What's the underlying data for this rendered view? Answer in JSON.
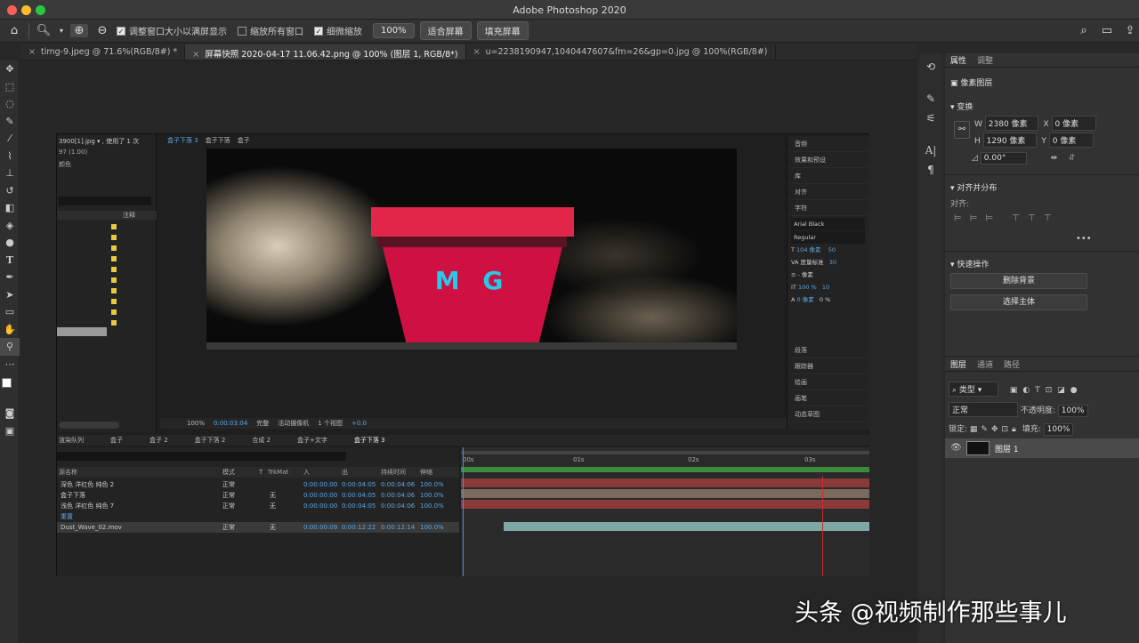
{
  "app": {
    "title": "Adobe Photoshop 2020"
  },
  "colors": {
    "accent": "#2680eb",
    "bar_red": "#e2264a",
    "pot_red": "#cf1042",
    "mg_text": "#26c9e8"
  },
  "options_bar": {
    "check_fit": "调整窗口大小以满屏显示",
    "check_zoom_all": "缩放所有窗口",
    "check_scrubby": "细微缩放",
    "zoom_value": "100%",
    "fit_screen": "适合屏幕",
    "fill_screen": "填充屏幕"
  },
  "tabs": [
    {
      "label": "timg-9.jpeg @ 71.6%(RGB/8#) *"
    },
    {
      "label": "屏幕快照 2020-04-17 11.06.42.png @ 100% (图层 1, RGB/8*)"
    },
    {
      "label": "u=2238190947,1040447607&fm=26&gp=0.jpg @ 100%(RGB/8#)"
    }
  ],
  "ae": {
    "project": {
      "file": "3900[1].jpg ▾ , 使用了 1 次",
      "line2": "97 (1.00)",
      "line3": "颜色",
      "col_note": "注释"
    },
    "breadcrumb": [
      "盒子下落 3",
      "盒子下落",
      "盒子"
    ],
    "comp_text": "M G",
    "viewer_bar": {
      "zoom": "100%",
      "time": "0:00:03:04",
      "quality": "完整",
      "camera": "活动摄像机",
      "views": "1 个视图",
      "offset": "+0.0"
    },
    "right_panels": [
      "音频",
      "效果和预设",
      "库",
      "对齐",
      "字符"
    ],
    "char": {
      "font": "Arial Black",
      "style": "Regular",
      "size": "104 像素",
      "kerning": "度量标准",
      "px": "- 像素",
      "scale_v": "100 %",
      "baseline": "0 像素",
      "tsize": "50",
      "track": "30",
      "t10": "10",
      "pct": "0 %"
    },
    "right_panels_bottom": [
      "段落",
      "跟踪器",
      "绘画",
      "画笔",
      "动态草图"
    ],
    "timeline_tabs": [
      "渲染队列",
      "盒子",
      "盒子 2",
      "盒子下落 2",
      "合成 2",
      "盒子+文字",
      "盒子下落 3"
    ],
    "tl_headers": {
      "name": "源名称",
      "mode": "模式",
      "t": "T",
      "trkmat": "TrkMat",
      "in": "入",
      "out": "出",
      "dur": "持续时间",
      "stretch": "伸缩"
    },
    "ruler": [
      "00s",
      "01s",
      "02s",
      "03s"
    ],
    "layers": [
      {
        "name": "深色 洋红色 纯色 2",
        "mode": "正常",
        "trk": "",
        "in": "0:00:00:00",
        "out": "0:00:04:05",
        "dur": "0:00:04:06",
        "stretch": "100.0%"
      },
      {
        "name": "盒子下落",
        "mode": "正常",
        "trk": "无",
        "in": "0:00:00:00",
        "out": "0:00:04:05",
        "dur": "0:00:04:06",
        "stretch": "100.0%"
      },
      {
        "name": "浅色 洋红色 纯色 7",
        "mode": "正常",
        "trk": "无",
        "in": "0:00:00:00",
        "out": "0:00:04:05",
        "dur": "0:00:04:06",
        "stretch": "100.0%"
      },
      {
        "name": "重置",
        "mode": "",
        "trk": "",
        "in": "",
        "out": "",
        "dur": "",
        "stretch": ""
      },
      {
        "name": "Dust_Wave_02.mov",
        "mode": "正常",
        "trk": "无",
        "in": "0:00:00:09",
        "out": "0:00:12:22",
        "dur": "0:00:12:14",
        "stretch": "100.0%"
      }
    ]
  },
  "properties": {
    "tabs": [
      "属性",
      "调整"
    ],
    "layer_type": "像素图层",
    "transform": "变换",
    "w": "2380 像素",
    "h": "1290 像素",
    "x": "0 像素",
    "y": "0 像素",
    "angle": "0.00°",
    "align_title": "对齐并分布",
    "align_label": "对齐:",
    "quick": "快速操作",
    "remove_bg": "删除背景",
    "select_subject": "选择主体"
  },
  "layers_panel": {
    "tabs": [
      "图层",
      "通道",
      "路径"
    ],
    "kind": "类型",
    "blend": "正常",
    "opacity_label": "不透明度:",
    "opacity": "100%",
    "lock_label": "锁定:",
    "fill_label": "填充:",
    "fill": "100%",
    "layer_name": "图层 1"
  },
  "watermark": "头条 @视频制作那些事儿"
}
